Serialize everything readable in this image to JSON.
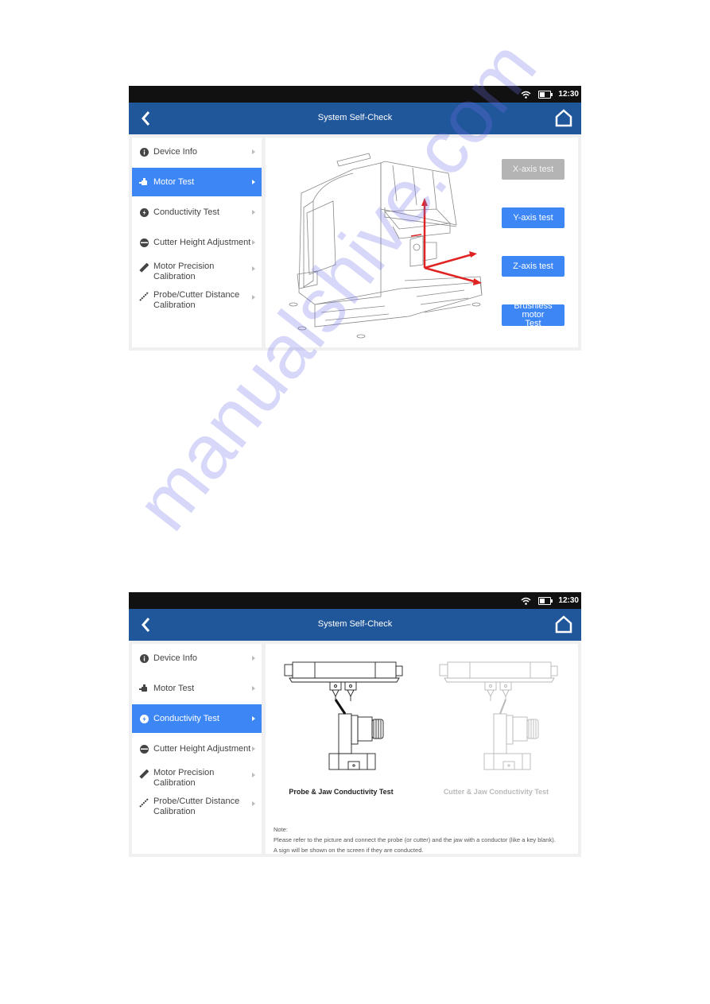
{
  "screens": [
    {
      "status_bar": {
        "time": "12:30",
        "wifi_icon": "wifi-icon",
        "battery_icon": "battery-icon"
      },
      "header": {
        "title": "System Self-Check",
        "back_icon": "chevron-left-icon",
        "home_icon": "home-icon"
      },
      "sidebar": {
        "active_index": 1,
        "items": [
          {
            "label": "Device Info",
            "icon": "info-icon"
          },
          {
            "label": "Motor Test",
            "icon": "motor-icon"
          },
          {
            "label": "Conductivity Test",
            "icon": "conductivity-icon"
          },
          {
            "label": "Cutter Height Adjustment",
            "icon": "cutter-icon"
          },
          {
            "label_line1": "Motor Precision",
            "label_line2": "Calibration",
            "icon": "ruler-icon"
          },
          {
            "label_line1": "Probe/Cutter Distance",
            "label_line2": "Calibration",
            "icon": "probe-icon"
          }
        ]
      },
      "main": {
        "illustration": "key-cutting-machine-with-axes",
        "buttons": [
          {
            "label": "X-axis test",
            "state": "disabled"
          },
          {
            "label": "Y-axis test",
            "state": "enabled"
          },
          {
            "label": "Z-axis test",
            "state": "enabled"
          },
          {
            "label_line1": "Brushless motor",
            "label_line2": "Test",
            "state": "enabled"
          }
        ]
      }
    },
    {
      "status_bar": {
        "time": "12:30",
        "wifi_icon": "wifi-icon",
        "battery_icon": "battery-icon"
      },
      "header": {
        "title": "System Self-Check",
        "back_icon": "chevron-left-icon",
        "home_icon": "home-icon"
      },
      "sidebar": {
        "active_index": 2,
        "items": [
          {
            "label": "Device Info",
            "icon": "info-icon"
          },
          {
            "label": "Motor Test",
            "icon": "motor-icon"
          },
          {
            "label": "Conductivity Test",
            "icon": "conductivity-icon"
          },
          {
            "label": "Cutter Height Adjustment",
            "icon": "cutter-icon"
          },
          {
            "label_line1": "Motor Precision",
            "label_line2": "Calibration",
            "icon": "ruler-icon"
          },
          {
            "label_line1": "Probe/Cutter Distance",
            "label_line2": "Calibration",
            "icon": "probe-icon"
          }
        ]
      },
      "main": {
        "tests": [
          {
            "caption": "Probe & Jaw Conductivity Test",
            "state": "active"
          },
          {
            "caption": "Cutter & Jaw Conductivity Test",
            "state": "inactive"
          }
        ],
        "note_title": "Note:",
        "note_line1": "Please refer to the picture and connect the probe (or cutter) and the jaw with a conductor (like a key blank).",
        "note_line2": "A sign will be shown on the screen if they are conducted."
      }
    }
  ],
  "watermark": "manualshive.com",
  "colors": {
    "header": "#20569a",
    "active": "#3d86f5",
    "disabled": "#b4b4b4",
    "axis_arrow": "#e02424"
  }
}
